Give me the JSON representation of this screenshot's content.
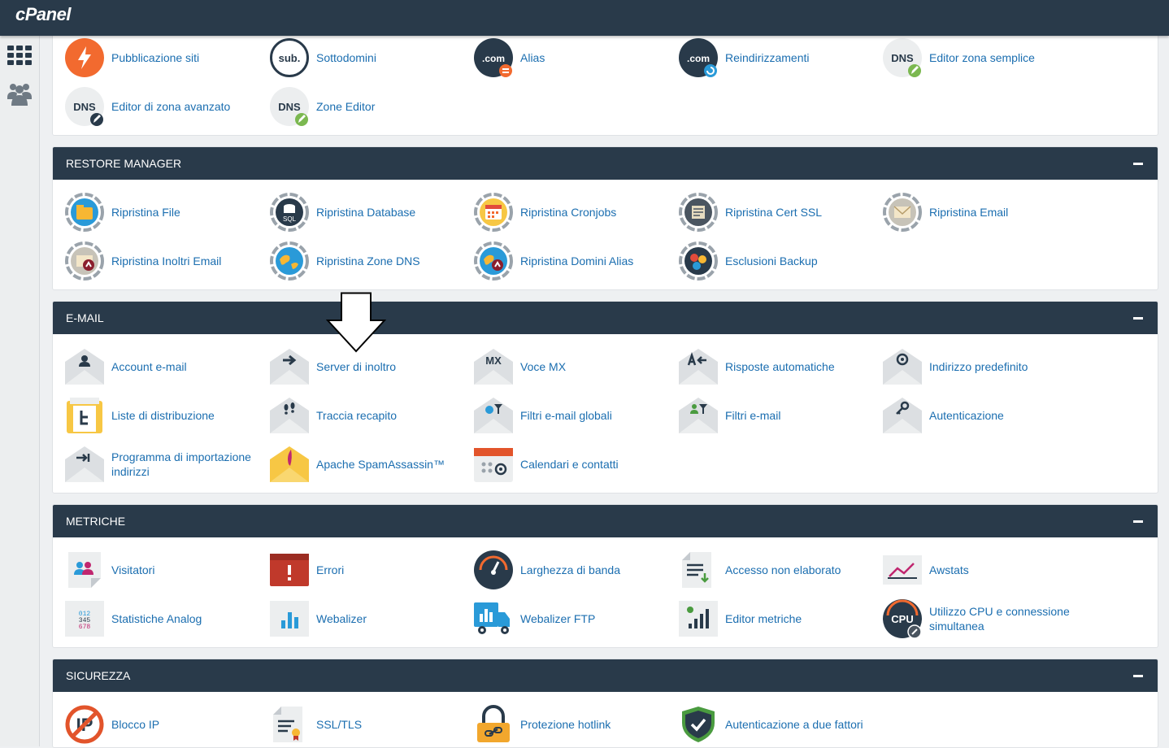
{
  "header": {
    "brand": "cPanel"
  },
  "sidebar": {
    "items": [
      {
        "icon": "grid-icon"
      },
      {
        "icon": "users-icon"
      }
    ]
  },
  "sections": {
    "domains": {
      "items": [
        {
          "label": "Pubblicazione siti",
          "icon": "lightning-icon"
        },
        {
          "label": "Sottodomini",
          "icon": "sub-icon"
        },
        {
          "label": "Alias",
          "icon": "dotcom-icon"
        },
        {
          "label": "Reindirizzamenti",
          "icon": "dotcom-redirect-icon"
        },
        {
          "label": "Editor zona semplice",
          "icon": "dns-icon"
        },
        {
          "label": "Editor di zona avanzato",
          "icon": "dns-advanced-icon"
        },
        {
          "label": "Zone Editor",
          "icon": "dns-edit-icon"
        }
      ]
    },
    "restore": {
      "title": "RESTORE MANAGER",
      "items": [
        {
          "label": "Ripristina File",
          "icon": "restore-file-icon"
        },
        {
          "label": "Ripristina Database",
          "icon": "restore-database-icon"
        },
        {
          "label": "Ripristina Cronjobs",
          "icon": "restore-cron-icon"
        },
        {
          "label": "Ripristina Cert SSL",
          "icon": "restore-ssl-icon"
        },
        {
          "label": "Ripristina Email",
          "icon": "restore-email-icon"
        },
        {
          "label": "Ripristina Inoltri Email",
          "icon": "restore-forwarders-icon"
        },
        {
          "label": "Ripristina Zone DNS",
          "icon": "restore-dns-icon"
        },
        {
          "label": "Ripristina Domini Alias",
          "icon": "restore-alias-icon"
        },
        {
          "label": "Esclusioni Backup",
          "icon": "backup-exclusions-icon"
        }
      ]
    },
    "email": {
      "title": "E-MAIL",
      "items": [
        {
          "label": "Account e-mail",
          "icon": "email-account-icon"
        },
        {
          "label": "Server di inoltro",
          "icon": "forwarder-icon"
        },
        {
          "label": "Voce MX",
          "icon": "mx-icon"
        },
        {
          "label": "Risposte automatiche",
          "icon": "autoresponder-icon"
        },
        {
          "label": "Indirizzo predefinito",
          "icon": "default-address-icon"
        },
        {
          "label": "Liste di distribuzione",
          "icon": "mailing-list-icon"
        },
        {
          "label": "Traccia recapito",
          "icon": "track-delivery-icon"
        },
        {
          "label": "Filtri e-mail globali",
          "icon": "global-filter-icon"
        },
        {
          "label": "Filtri e-mail",
          "icon": "email-filter-icon"
        },
        {
          "label": "Autenticazione",
          "icon": "authentication-icon"
        },
        {
          "label": "Programma di importazione indirizzi",
          "icon": "import-icon"
        },
        {
          "label": "Apache SpamAssassin™",
          "icon": "spamassassin-icon"
        },
        {
          "label": "Calendari e contatti",
          "icon": "calendar-icon"
        }
      ]
    },
    "metrics": {
      "title": "METRICHE",
      "items": [
        {
          "label": "Visitatori",
          "icon": "visitors-icon"
        },
        {
          "label": "Errori",
          "icon": "errors-icon"
        },
        {
          "label": "Larghezza di banda",
          "icon": "bandwidth-icon"
        },
        {
          "label": "Accesso non elaborato",
          "icon": "raw-access-icon"
        },
        {
          "label": "Awstats",
          "icon": "awstats-icon"
        },
        {
          "label": "Statistiche Analog",
          "icon": "analog-icon"
        },
        {
          "label": "Webalizer",
          "icon": "webalizer-icon"
        },
        {
          "label": "Webalizer FTP",
          "icon": "webalizer-ftp-icon"
        },
        {
          "label": "Editor metriche",
          "icon": "metrics-editor-icon"
        },
        {
          "label": "Utilizzo CPU e connessione simultanea",
          "icon": "cpu-icon"
        }
      ]
    },
    "security": {
      "title": "SICUREZZA",
      "items": [
        {
          "label": "Blocco IP",
          "icon": "ip-block-icon"
        },
        {
          "label": "SSL/TLS",
          "icon": "ssl-icon"
        },
        {
          "label": "Protezione hotlink",
          "icon": "hotlink-icon"
        },
        {
          "label": "Autenticazione a due fattori",
          "icon": "two-factor-icon"
        }
      ]
    }
  },
  "icon_text": {
    "sub": "sub.",
    "com": ".com",
    "dns": "DNS",
    "mx": "MX",
    "cpu": "CPU",
    "sql": "SQL",
    "analog": "012 345 678"
  },
  "colors": {
    "header_bg": "#293a4a",
    "link": "#1b6eb0",
    "accent_orange": "#f26a2f"
  }
}
